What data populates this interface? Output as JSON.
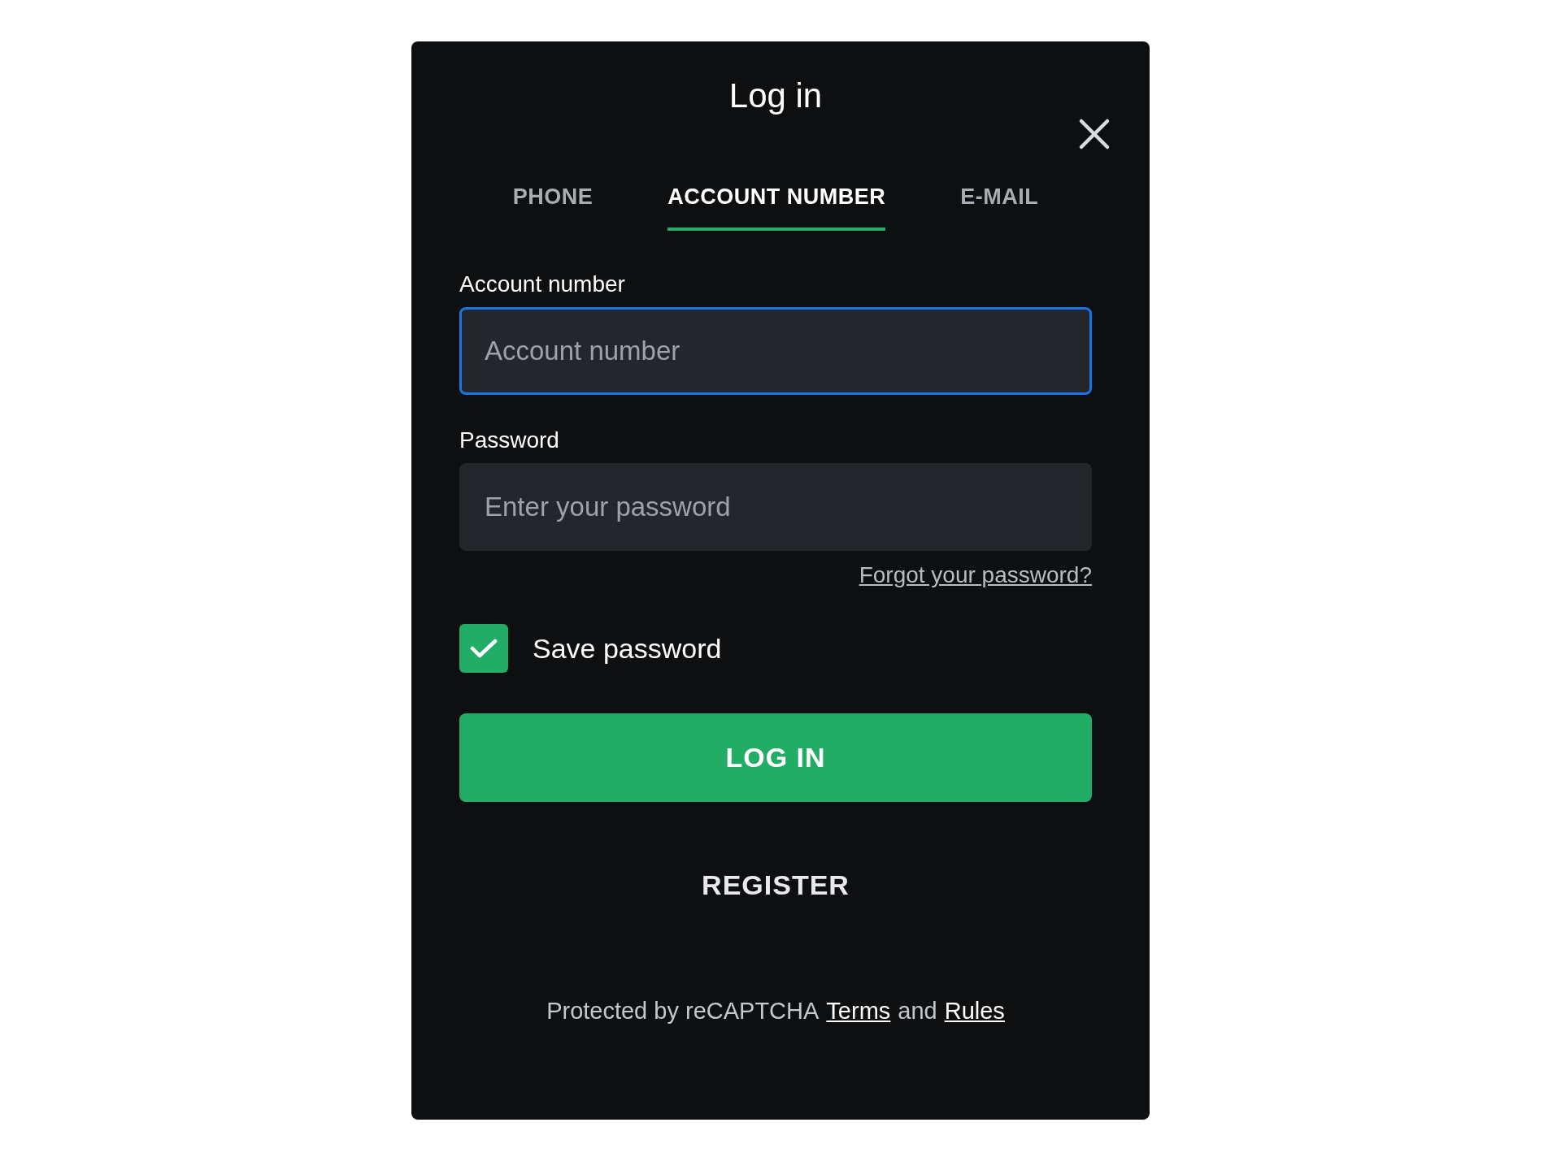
{
  "dialog": {
    "title": "Log in"
  },
  "tabs": [
    {
      "label": "PHONE",
      "selected": false
    },
    {
      "label": "ACCOUNT NUMBER",
      "selected": true
    },
    {
      "label": "E-MAIL",
      "selected": false
    }
  ],
  "fields": [
    {
      "label": "Account number",
      "placeholder": "Account number",
      "focused": true
    },
    {
      "label": "Password",
      "placeholder": "Enter your password",
      "focused": false
    }
  ],
  "forgot_link": "Forgot your password?",
  "save_password": {
    "label": "Save password",
    "checked": true
  },
  "login_button": "LOG IN",
  "register_button": "REGISTER",
  "footer": {
    "text": "Protected by reCAPTCHA",
    "terms": "Terms",
    "and": "and",
    "rules": "Rules"
  }
}
